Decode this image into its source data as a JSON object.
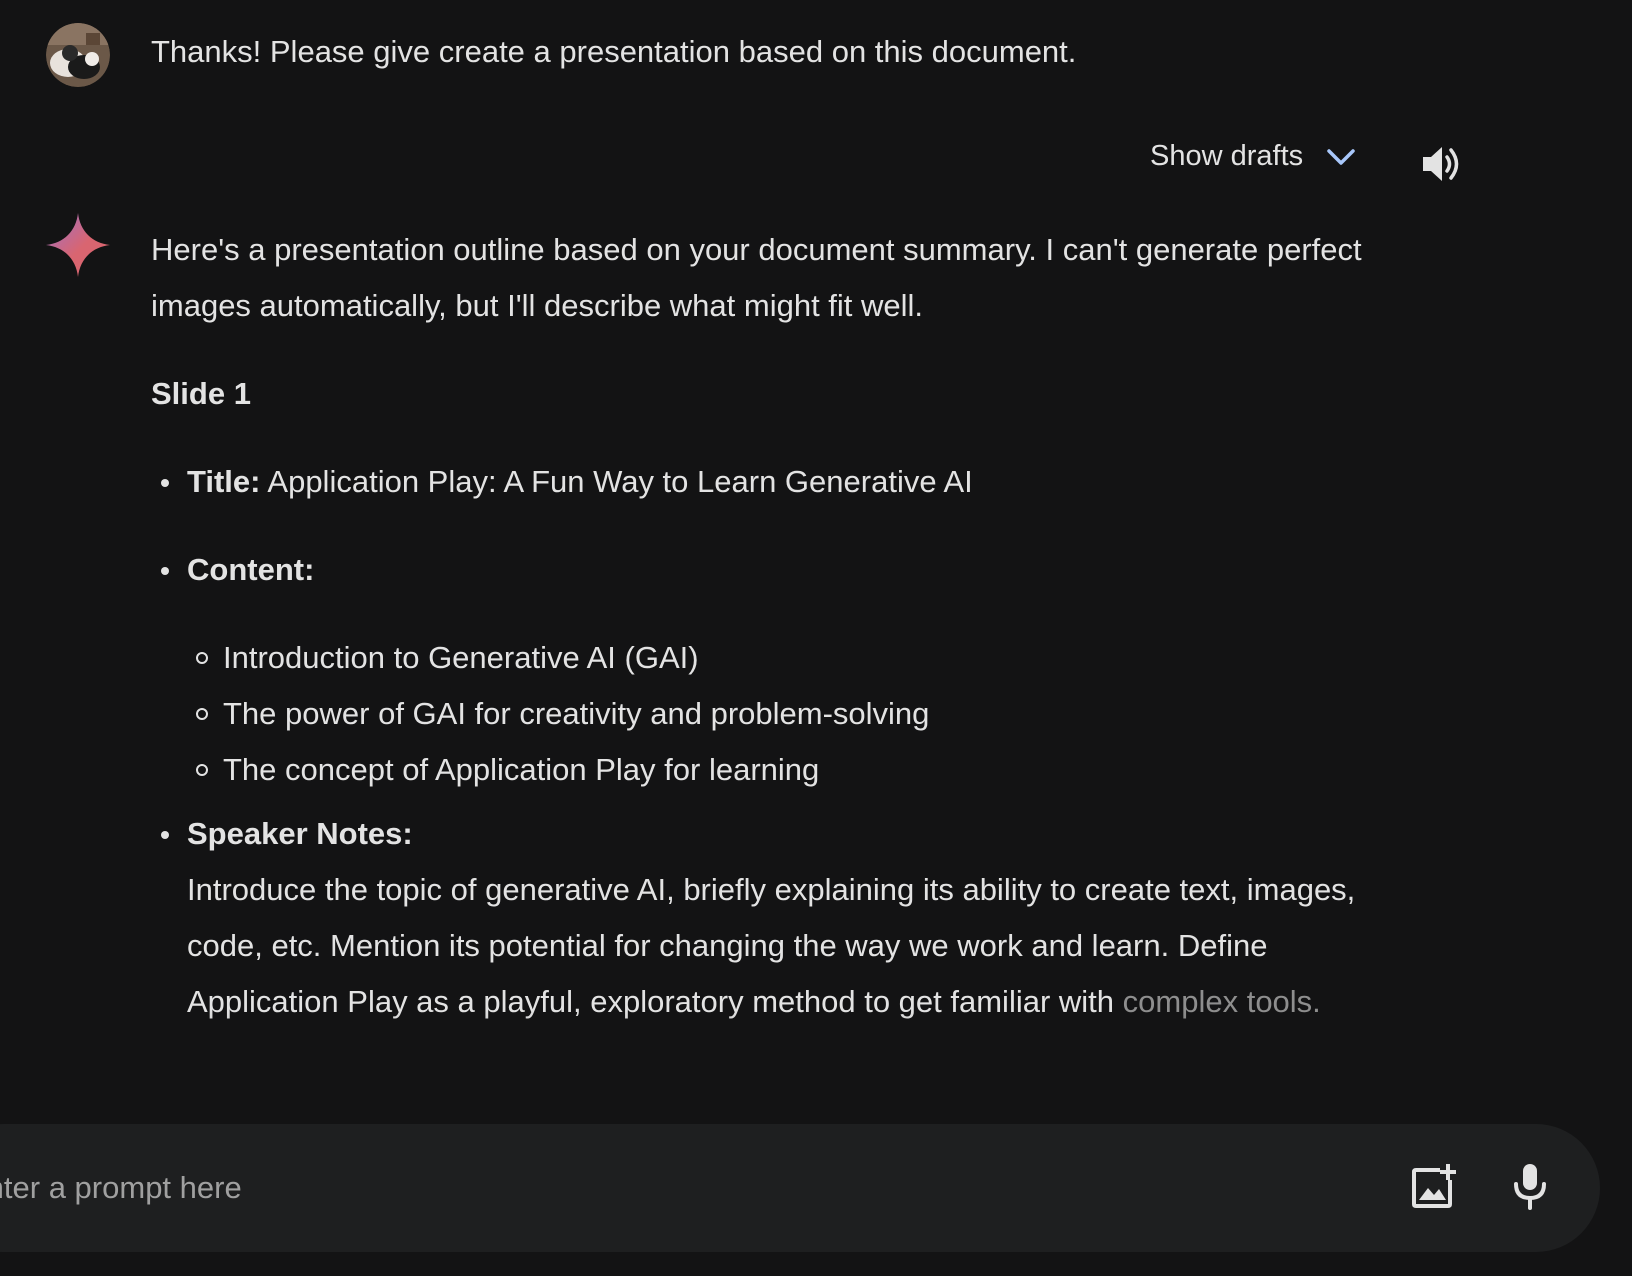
{
  "user_message": {
    "text": "Thanks! Please give create a presentation based on this document."
  },
  "response_header": {
    "show_drafts_label": "Show drafts"
  },
  "response": {
    "intro": "Here's a presentation outline based on your document summary. I can't generate perfect images automatically, but I'll describe what might fit well.",
    "slide_heading": "Slide 1",
    "title_label": "Title:",
    "title_value": " Application Play: A Fun Way to Learn Generative AI",
    "content_label": "Content:",
    "content_items": [
      "Introduction to Generative AI (GAI)",
      "The power of GAI for creativity and problem-solving",
      "The concept of Application Play for learning"
    ],
    "speaker_notes_label": "Speaker Notes:",
    "speaker_notes_text": "Introduce the topic of generative AI, briefly explaining its ability to create text, images, code, etc. Mention its potential for changing the way we work and learn. Define Application Play as a playful, exploratory method to get familiar with",
    "speaker_notes_tail": "complex tools."
  },
  "prompt": {
    "placeholder": "Enter a prompt here"
  },
  "icons": {
    "avatar": "avatar",
    "spark": "gemini-spark-icon",
    "chevron": "chevron-down-icon",
    "speaker": "speaker-icon",
    "add_image": "add-image-icon",
    "mic": "microphone-icon"
  },
  "colors": {
    "background": "#131314",
    "text": "#e3e3e3",
    "prompt_bar": "#1e1f20",
    "accent_blue": "#a8c7fa"
  }
}
